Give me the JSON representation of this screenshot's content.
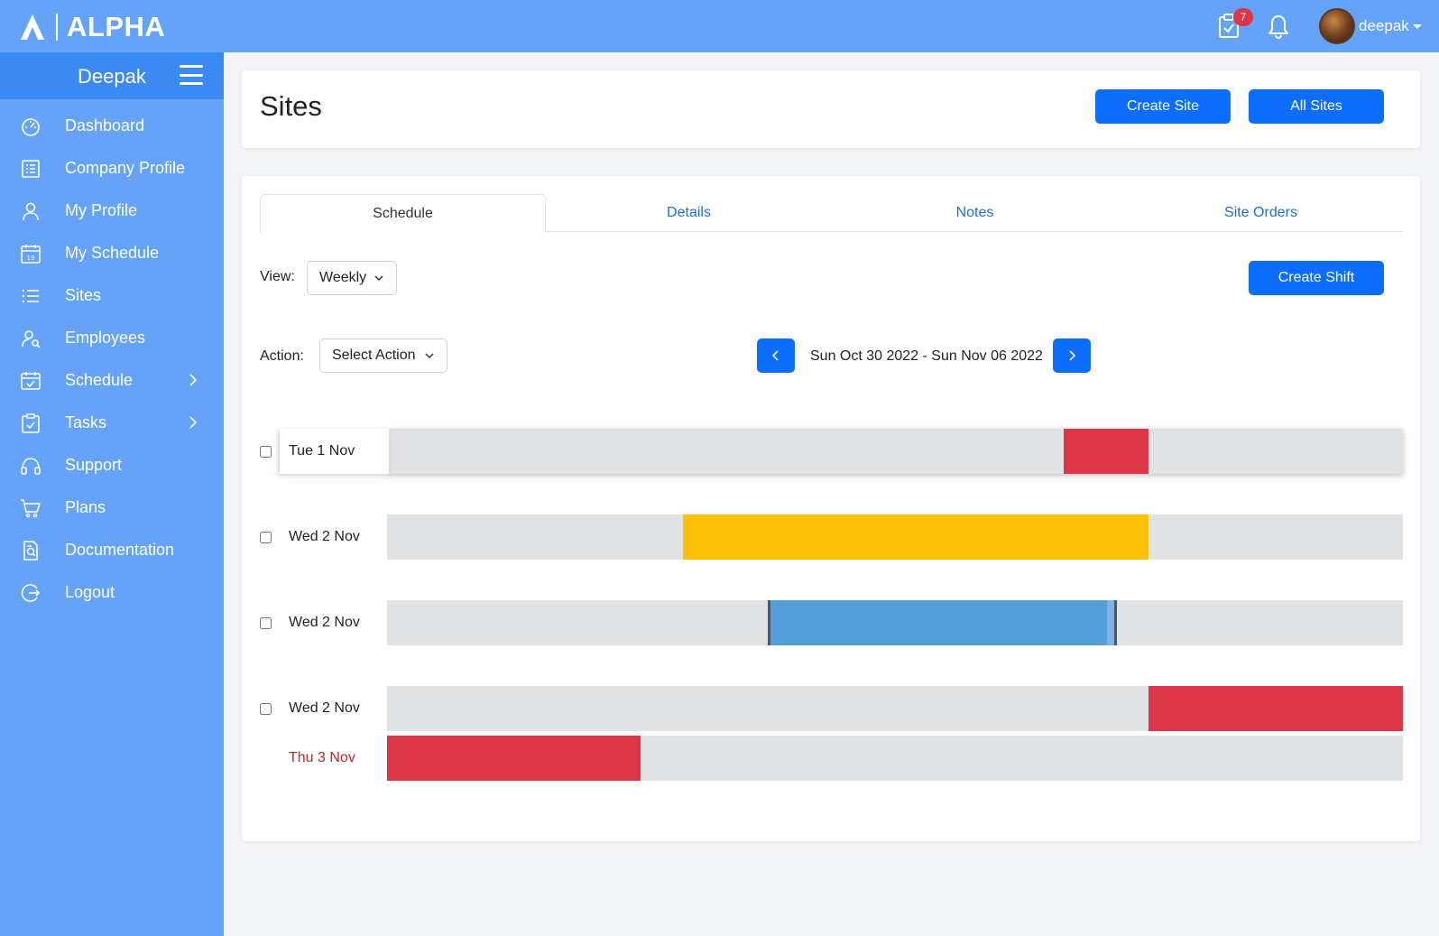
{
  "brand": {
    "name": "ALPHA"
  },
  "topbar": {
    "tasks_badge": "7",
    "user_name": "deepak"
  },
  "sidebar": {
    "user": "Deepak",
    "items": [
      {
        "label": "Dashboard",
        "icon": "dashboard-icon"
      },
      {
        "label": "Company Profile",
        "icon": "company-profile-icon"
      },
      {
        "label": "My Profile",
        "icon": "user-icon"
      },
      {
        "label": "My Schedule",
        "icon": "calendar-icon"
      },
      {
        "label": "Sites",
        "icon": "list-icon"
      },
      {
        "label": "Employees",
        "icon": "employees-icon"
      },
      {
        "label": "Schedule",
        "icon": "schedule-icon"
      },
      {
        "label": "Tasks",
        "icon": "tasks-icon"
      },
      {
        "label": "Support",
        "icon": "support-icon"
      },
      {
        "label": "Plans",
        "icon": "cart-icon"
      },
      {
        "label": "Documentation",
        "icon": "documentation-icon"
      },
      {
        "label": "Logout",
        "icon": "logout-icon"
      }
    ]
  },
  "header": {
    "title": "Sites",
    "create_site": "Create Site",
    "all_sites": "All Sites"
  },
  "tabs": [
    "Schedule",
    "Details",
    "Notes",
    "Site Orders"
  ],
  "controls": {
    "view_label": "View:",
    "view_value": "Weekly",
    "action_label": "Action:",
    "action_value": "Select Action",
    "create_shift": "Create Shift",
    "date_range": "Sun Oct 30 2022 - Sun Nov 06 2022"
  },
  "rows": [
    {
      "label": "Tue 1 Nov"
    },
    {
      "label": "Wed 2 Nov"
    },
    {
      "label": "Wed 2 Nov"
    },
    {
      "label": "Wed 2 Nov"
    },
    {
      "label": "Thu 3 Nov"
    }
  ],
  "colors": {
    "red": "#dc3545",
    "yellow": "#ffc107",
    "blue": "#559fd9",
    "track": "#e1e2e4",
    "primary": "#0d6efd",
    "sidebar": "#64a3f8"
  }
}
